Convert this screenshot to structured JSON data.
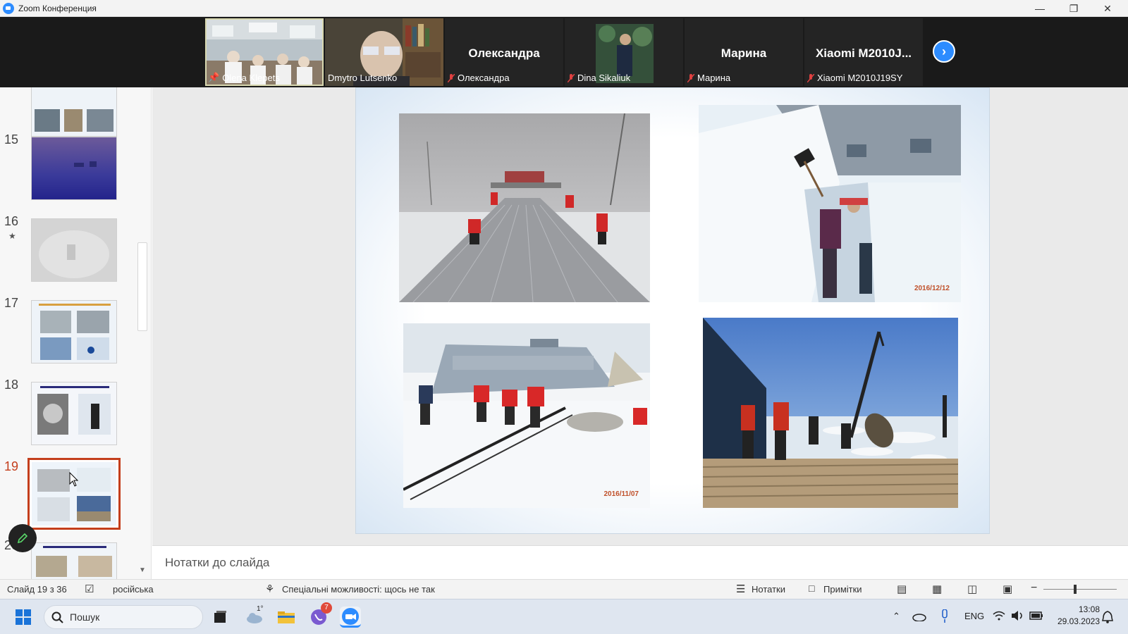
{
  "window": {
    "title": "Zoom Конференция",
    "controls": [
      "minimize",
      "restore",
      "close"
    ]
  },
  "gallery": {
    "participants": [
      {
        "label": "Olena Klepets",
        "has_video": true,
        "pinned": true,
        "active": true
      },
      {
        "label": "Dmytro Lutsenko",
        "has_video": true
      },
      {
        "display": "Олександра",
        "label": "Олександра",
        "has_video": false,
        "muted": true
      },
      {
        "label": "Dina Sikaliuk",
        "has_video": true,
        "muted": true
      },
      {
        "display": "Марина",
        "label": "Марина",
        "has_video": false,
        "muted": true
      },
      {
        "display": "Xiaomi  M2010J...",
        "label": "Xiaomi M2010J19SY",
        "has_video": false,
        "muted": true
      }
    ],
    "next_icon": "chevron-right-icon"
  },
  "slides_panel": {
    "items": [
      {
        "number": "",
        "partial": true
      },
      {
        "number": "15"
      },
      {
        "number": "16",
        "has_animation": true
      },
      {
        "number": "17"
      },
      {
        "number": "18"
      },
      {
        "number": "19",
        "selected": true
      },
      {
        "number": "20",
        "partial": true
      }
    ]
  },
  "slide": {
    "photos": [
      {
        "name": "roof-snow-clearing",
        "date": ""
      },
      {
        "name": "snow-wall-digging",
        "date": "2016/12/12"
      },
      {
        "name": "team-pulling-cable",
        "date": "2016/11/07"
      },
      {
        "name": "crane-on-pier",
        "date": ""
      }
    ]
  },
  "notes": {
    "placeholder": "Нотатки до слайда"
  },
  "statusbar": {
    "slide_counter": "Слайд 19 з 36",
    "language": "російська",
    "accessibility": "Спеціальні можливості: щось не так",
    "notes_button": "Нотатки",
    "comments_button": "Примітки"
  },
  "taskbar": {
    "search_label": "Пошук",
    "weather_temp": "1°",
    "viber_badge": "7",
    "language": "ENG",
    "time": "13:08",
    "date": "29.03.2023"
  },
  "colors": {
    "selection": "#c43e1c",
    "zoom_blue": "#2d8cff",
    "gallery_bg": "#1a1a1a"
  }
}
